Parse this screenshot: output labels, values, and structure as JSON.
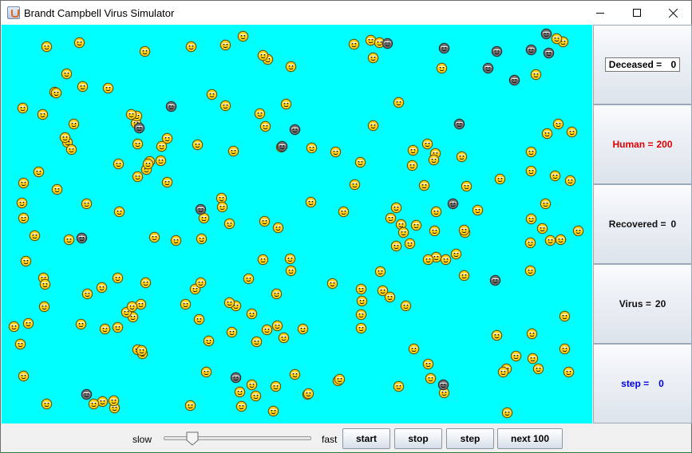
{
  "window": {
    "title": "Brandt Campbell Virus Simulator"
  },
  "colors": {
    "field_background": "#00ffff",
    "human_face": "#ffd21a",
    "virus_face": "#6e6e6e",
    "human_label": "#e00000",
    "step_label": "#0000e0"
  },
  "stats": {
    "deceased_label": "Deceased =",
    "deceased_value": "0",
    "human_label": "Human =",
    "human_value": "200",
    "recovered_label": "Recovered =",
    "recovered_value": "0",
    "virus_label": "Virus =",
    "virus_value": "20",
    "step_label": "step =",
    "step_value": "0"
  },
  "controls": {
    "slow_label": "slow",
    "fast_label": "fast",
    "speed_slider_value": 0.2,
    "start_label": "start",
    "stop_label": "stop",
    "step_label": "step",
    "next100_label": "next 100"
  },
  "icons": {
    "app": "java-cup-icon",
    "human": "smiley-face-icon",
    "virus": "virus-face-icon"
  }
}
